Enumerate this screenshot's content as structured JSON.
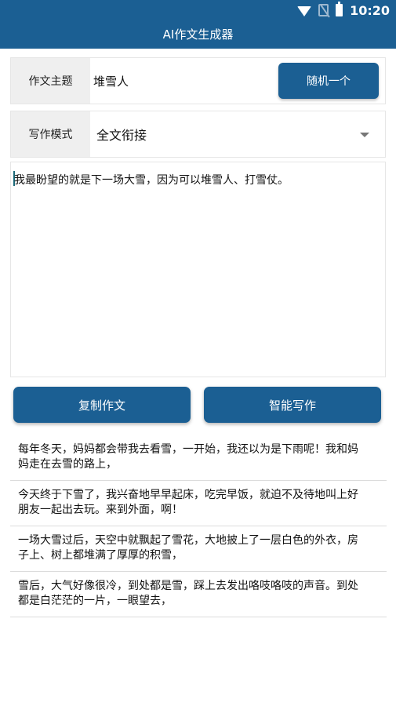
{
  "status_bar": {
    "time": "10:20",
    "icons": [
      "wifi-icon",
      "no-sim-icon",
      "battery-icon"
    ]
  },
  "app_bar": {
    "title": "AI作文生成器"
  },
  "topic": {
    "label": "作文主题",
    "value": "堆雪人",
    "random_button": "随机一个"
  },
  "mode": {
    "label": "写作模式",
    "value": "全文衔接"
  },
  "editor": {
    "text": "我最盼望的就是下一场大雪，因为可以堆雪人、打雪仗。"
  },
  "actions": {
    "copy": "复制作文",
    "smart_write": "智能写作"
  },
  "results": [
    {
      "line1": "每年冬天，妈妈都会带我去看雪，一开始，我还以为是下雨呢！我和妈",
      "line2": "妈走在去雪的路上，"
    },
    {
      "line1": "今天终于下雪了，我兴奋地早早起床，吃完早饭，就迫不及待地叫上好",
      "line2": "朋友一起出去玩。来到外面，啊！"
    },
    {
      "line1": "一场大雪过后，天空中就飘起了雪花，大地披上了一层白色的外衣，房",
      "line2": "子上、树上都堆满了厚厚的积雪，"
    },
    {
      "line1": "雪后，大气好像很冷，到处都是雪，踩上去发出咯吱咯吱的声音。到处",
      "line2": "都是白茫茫的一片，一眼望去，"
    }
  ],
  "colors": {
    "primary": "#1b5f93",
    "label_bg": "#efefef",
    "divider": "#dcdcdc"
  }
}
